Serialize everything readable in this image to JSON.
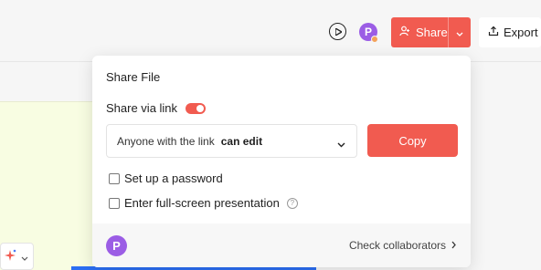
{
  "toolbar": {
    "play_icon": "play-circle-icon",
    "avatar_initial": "P",
    "share_label": "Share",
    "export_label": "Export",
    "accent_color": "#f15b50",
    "avatar_color": "#9b5de5"
  },
  "share_popover": {
    "title": "Share File",
    "via_link_label": "Share via link",
    "via_link_enabled": true,
    "permission_prefix": "Anyone with the link",
    "permission_value": "can edit",
    "copy_label": "Copy",
    "options": [
      {
        "label": "Set up a password",
        "checked": false
      },
      {
        "label": "Enter full-screen presentation",
        "checked": false,
        "help": "?"
      }
    ],
    "footer": {
      "avatar_initial": "P",
      "collaborators_label": "Check collaborators"
    }
  }
}
